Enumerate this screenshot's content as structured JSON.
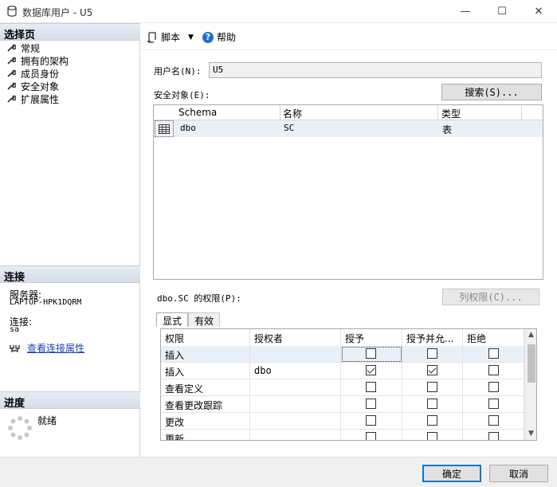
{
  "window": {
    "title": "数据库用户 - U5",
    "minimize": "—",
    "maximize": "☐",
    "close": "✕"
  },
  "left_panel": {
    "select_page_header": "选择页",
    "pages": [
      {
        "label": "常规"
      },
      {
        "label": "拥有的架构"
      },
      {
        "label": "成员身份"
      },
      {
        "label": "安全对象"
      },
      {
        "label": "扩展属性"
      }
    ],
    "connection_header": "连接",
    "server_label": "服务器:",
    "server_value": "LAPTOP-HPK1DQRM",
    "connection_label": "连接:",
    "connection_value": "sa",
    "view_connection_properties": "查看连接属性",
    "progress_header": "进度",
    "progress_status": "就绪"
  },
  "toolbar": {
    "script_label": "脚本",
    "help_label": "帮助"
  },
  "form": {
    "username_label": "用户名(N):",
    "username_value": "U5",
    "securables_label": "安全对象(E):",
    "search_button": "搜索(S)..."
  },
  "securables_grid": {
    "columns": [
      "Schema",
      "名称",
      "类型"
    ],
    "rows": [
      {
        "schema": "dbo",
        "name": "SC",
        "type": "表"
      }
    ]
  },
  "permissions": {
    "label": "dbo.SC 的权限(P):",
    "column_permissions_button": "列权限(C)...",
    "tabs": [
      {
        "label": "显式",
        "active": true
      },
      {
        "label": "有效",
        "active": false
      }
    ],
    "columns": [
      "权限",
      "授权者",
      "授予",
      "授予并允...",
      "拒绝"
    ],
    "rows": [
      {
        "permission": "插入",
        "grantor": "",
        "grant": false,
        "with_grant": false,
        "deny": false
      },
      {
        "permission": "插入",
        "grantor": "dbo",
        "grant": true,
        "with_grant": true,
        "deny": false
      },
      {
        "permission": "查看定义",
        "grantor": "",
        "grant": false,
        "with_grant": false,
        "deny": false
      },
      {
        "permission": "查看更改跟踪",
        "grantor": "",
        "grant": false,
        "with_grant": false,
        "deny": false
      },
      {
        "permission": "更改",
        "grantor": "",
        "grant": false,
        "with_grant": false,
        "deny": false
      },
      {
        "permission": "更新",
        "grantor": "",
        "grant": false,
        "with_grant": false,
        "deny": false
      }
    ]
  },
  "footer": {
    "ok_button": "确定",
    "cancel_button": "取消"
  }
}
